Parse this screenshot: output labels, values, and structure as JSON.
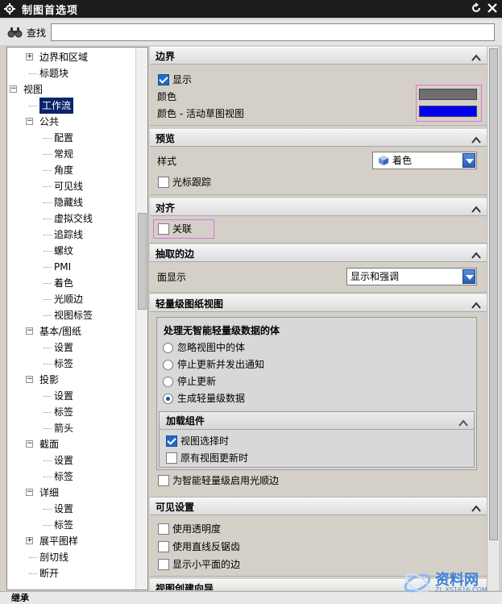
{
  "window": {
    "title": "制图首选项"
  },
  "search": {
    "label": "查找",
    "value": "",
    "placeholder": ""
  },
  "tree": {
    "items": [
      {
        "label": "边界和区域",
        "level": 1,
        "expander": "+"
      },
      {
        "label": "标题块",
        "level": 1,
        "expander": ""
      },
      {
        "label": "视图",
        "level": 0,
        "expander": "-"
      },
      {
        "label": "工作流",
        "level": 1,
        "expander": "",
        "selected": true
      },
      {
        "label": "公共",
        "level": 1,
        "expander": "-"
      },
      {
        "label": "配置",
        "level": 2,
        "expander": ""
      },
      {
        "label": "常规",
        "level": 2,
        "expander": ""
      },
      {
        "label": "角度",
        "level": 2,
        "expander": ""
      },
      {
        "label": "可见线",
        "level": 2,
        "expander": ""
      },
      {
        "label": "隐藏线",
        "level": 2,
        "expander": ""
      },
      {
        "label": "虚拟交线",
        "level": 2,
        "expander": ""
      },
      {
        "label": "追踪线",
        "level": 2,
        "expander": ""
      },
      {
        "label": "螺纹",
        "level": 2,
        "expander": ""
      },
      {
        "label": "PMI",
        "level": 2,
        "expander": ""
      },
      {
        "label": "着色",
        "level": 2,
        "expander": ""
      },
      {
        "label": "光顺边",
        "level": 2,
        "expander": ""
      },
      {
        "label": "视图标签",
        "level": 2,
        "expander": ""
      },
      {
        "label": "基本/图纸",
        "level": 1,
        "expander": "-"
      },
      {
        "label": "设置",
        "level": 2,
        "expander": ""
      },
      {
        "label": "标签",
        "level": 2,
        "expander": ""
      },
      {
        "label": "投影",
        "level": 1,
        "expander": "-"
      },
      {
        "label": "设置",
        "level": 2,
        "expander": ""
      },
      {
        "label": "标签",
        "level": 2,
        "expander": ""
      },
      {
        "label": "箭头",
        "level": 2,
        "expander": ""
      },
      {
        "label": "截面",
        "level": 1,
        "expander": "-"
      },
      {
        "label": "设置",
        "level": 2,
        "expander": ""
      },
      {
        "label": "标签",
        "level": 2,
        "expander": ""
      },
      {
        "label": "详细",
        "level": 1,
        "expander": "-"
      },
      {
        "label": "设置",
        "level": 2,
        "expander": ""
      },
      {
        "label": "标签",
        "level": 2,
        "expander": ""
      },
      {
        "label": "展平图样",
        "level": 1,
        "expander": "+"
      },
      {
        "label": "剖切线",
        "level": 1,
        "expander": ""
      },
      {
        "label": "断开",
        "level": 1,
        "expander": ""
      }
    ]
  },
  "border_section": {
    "title": "边界",
    "show_label": "显示",
    "show_checked": true,
    "color_label": "颜色",
    "active_color_label": "颜色 - 活动草图视图",
    "color_value": "#6e6e6e",
    "active_color_value": "#0000ee"
  },
  "preview_section": {
    "title": "预览",
    "style_label": "样式",
    "style_value": "着色",
    "cursor_track_label": "光标跟踪",
    "cursor_track_checked": false
  },
  "align_section": {
    "title": "对齐",
    "associative_label": "关联",
    "associative_checked": false
  },
  "extracted_edges_section": {
    "title": "抽取的边",
    "face_display_label": "面显示",
    "face_display_value": "显示和强调"
  },
  "lightweight_section": {
    "title": "轻量级图纸视图",
    "group_title": "处理无智能轻量级数据的体",
    "options": [
      {
        "label": "忽略视图中的体",
        "selected": false
      },
      {
        "label": "停止更新并发出通知",
        "selected": false
      },
      {
        "label": "停止更新",
        "selected": false
      },
      {
        "label": "生成轻量级数据",
        "selected": true
      }
    ],
    "load_group_title": "加载组件",
    "load_options": [
      {
        "label": "视图选择时",
        "checked": true
      },
      {
        "label": "原有视图更新时",
        "checked": false
      }
    ],
    "smooth_edge_label": "为智能轻量级启用光顺边",
    "smooth_edge_checked": false
  },
  "visible_section": {
    "title": "可见设置",
    "options": [
      {
        "label": "使用透明度",
        "checked": false
      },
      {
        "label": "使用直线反锯齿",
        "checked": false
      },
      {
        "label": "显示小平面的边",
        "checked": false
      }
    ]
  },
  "next_section": {
    "title": "视图创建向导"
  },
  "footer": {
    "label": "继承"
  },
  "watermark": {
    "text": "资料网",
    "sub": "ZL.XS1616.COM"
  }
}
